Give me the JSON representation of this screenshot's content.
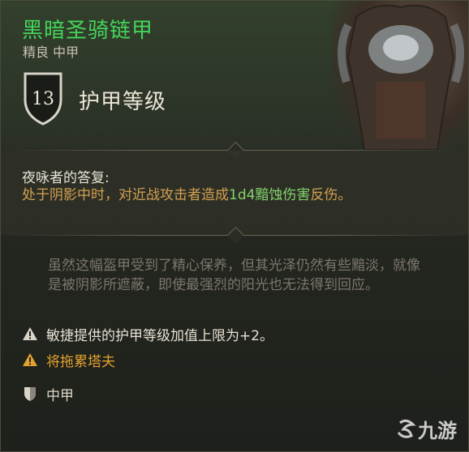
{
  "item": {
    "name": "黑暗圣骑链甲",
    "subtitle": "精良 中甲",
    "armor_class_value": "13",
    "armor_class_label": "护甲等级"
  },
  "passive": {
    "name": "夜咏者的答复:",
    "desc_before": "处于阴影中时，对近战攻击者造成",
    "desc_highlight": "1d4黯蚀伤害",
    "desc_after": "反伤。"
  },
  "lore": "虽然这幅盔甲受到了精心保养，但其光泽仍然有些黯淡，就像是被阴影所遮蔽，即使最强烈的阳光也无法得到回应。",
  "properties": [
    {
      "text": "敏捷提供的护甲等级加值上限为+2。",
      "icon": "warning-icon"
    },
    {
      "text": "将拖累塔夫",
      "icon": "warning-icon"
    },
    {
      "text": "中甲",
      "icon": "shield-icon"
    }
  ],
  "watermark": "九游",
  "colors": {
    "title": "#43d55a",
    "passive_desc": "#d2a050",
    "highlight": "#84d36d",
    "warning": "#e3a22e"
  }
}
